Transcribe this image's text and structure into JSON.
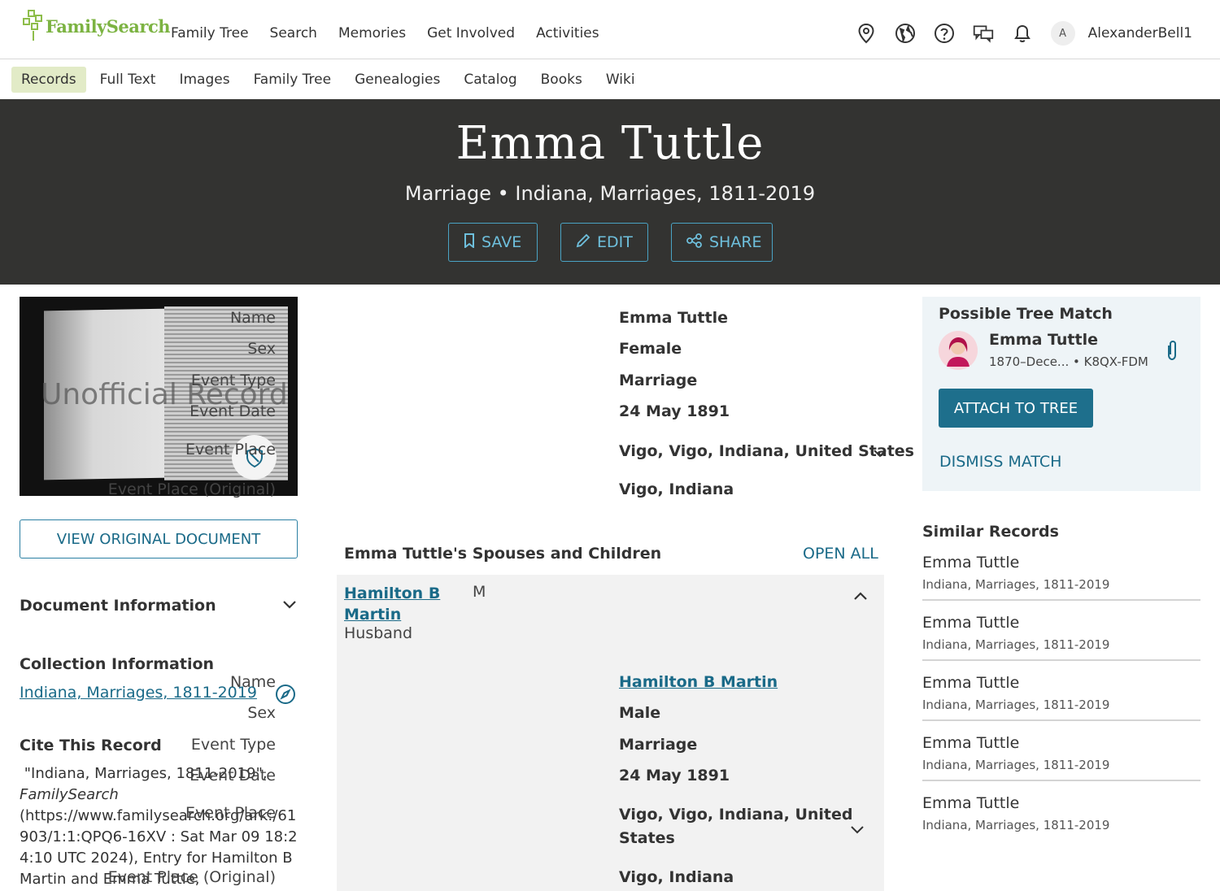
{
  "topnav": {
    "logo_text": "FamilySearch",
    "links": [
      "Family Tree",
      "Search",
      "Memories",
      "Get Involved",
      "Activities"
    ],
    "username": "AlexanderBell1",
    "avatar_initial": "A"
  },
  "subnav": {
    "links": [
      "Records",
      "Full Text",
      "Images",
      "Family Tree",
      "Genealogies",
      "Catalog",
      "Books",
      "Wiki"
    ],
    "active": "Records"
  },
  "hero": {
    "title": "Emma Tuttle",
    "subtitle": "Marriage • Indiana, Marriages, 1811-2019",
    "save_label": "SAVE",
    "edit_label": "EDIT",
    "share_label": "SHARE"
  },
  "left": {
    "watermark": "Unofficial Record",
    "view_original_label": "VIEW ORIGINAL DOCUMENT",
    "document_information_label": "Document Information",
    "collection_information_label": "Collection Information",
    "collection_link": "Indiana, Marriages, 1811-2019",
    "cite_title": "Cite This Record",
    "cite_text_1": "\"Indiana, Marriages, 1811-2019\",",
    "cite_text_italic": "FamilySearch",
    "cite_text_2": "(https://www.familysearch.org/ark:/61903/1:1:QPQ6-16XV : Sat Mar 09 18:24:10 UTC 2024), Entry for Hamilton B Martin and Emma Tuttle,"
  },
  "details": [
    {
      "label": "Name",
      "value": "Emma Tuttle"
    },
    {
      "label": "Sex",
      "value": "Female"
    },
    {
      "label": "Event Type",
      "value": "Marriage"
    },
    {
      "label": "Event Date",
      "value": "24 May 1891"
    },
    {
      "label": "Event Place",
      "value": "Vigo, Vigo, Indiana, United States"
    },
    {
      "label": "Event Place (Original)",
      "value": "Vigo, Indiana"
    }
  ],
  "spouses": {
    "heading": "Emma Tuttle's Spouses and Children",
    "open_all_label": "OPEN ALL",
    "spouse_name_line1": "Hamilton B",
    "spouse_name_line2": "Martin",
    "spouse_sex": "M",
    "spouse_relation": "Husband",
    "details": [
      {
        "label": "Name",
        "value": "Hamilton B Martin"
      },
      {
        "label": "Sex",
        "value": "Male"
      },
      {
        "label": "Event Type",
        "value": "Marriage"
      },
      {
        "label": "Event Date",
        "value": "24 May 1891"
      },
      {
        "label": "Event Place",
        "value_line1": "Vigo, Vigo, Indiana, United",
        "value_line2": "States"
      },
      {
        "label": "Event Place (Original)",
        "value": "Vigo, Indiana"
      }
    ]
  },
  "tree_match": {
    "title": "Possible Tree Match",
    "name": "Emma Tuttle",
    "meta": "1870–Dece... • K8QX-FDM",
    "attach_label": "ATTACH TO TREE",
    "dismiss_label": "DISMISS MATCH"
  },
  "similar": {
    "title": "Similar Records",
    "items": [
      {
        "name": "Emma Tuttle",
        "collection": "Indiana, Marriages, 1811-2019"
      },
      {
        "name": "Emma Tuttle",
        "collection": "Indiana, Marriages, 1811-2019"
      },
      {
        "name": "Emma Tuttle",
        "collection": "Indiana, Marriages, 1811-2019"
      },
      {
        "name": "Emma Tuttle",
        "collection": "Indiana, Marriages, 1811-2019"
      },
      {
        "name": "Emma Tuttle",
        "collection": "Indiana, Marriages, 1811-2019"
      }
    ]
  },
  "colors": {
    "brand_green": "#7cb342",
    "hero_bg": "#333331",
    "link_blue": "#1a6a88",
    "button_blue": "#1e6f8c",
    "active_tab_bg": "#e2ebc7",
    "match_card_bg": "#eef4f7"
  },
  "icons": [
    "location-icon",
    "globe-icon",
    "help-icon",
    "chat-icon",
    "bell-icon",
    "bookmark-icon",
    "pencil-icon",
    "share-icon",
    "shield-icon",
    "chevron-down-icon",
    "chevron-up-icon",
    "compass-icon",
    "paperclip-icon"
  ]
}
